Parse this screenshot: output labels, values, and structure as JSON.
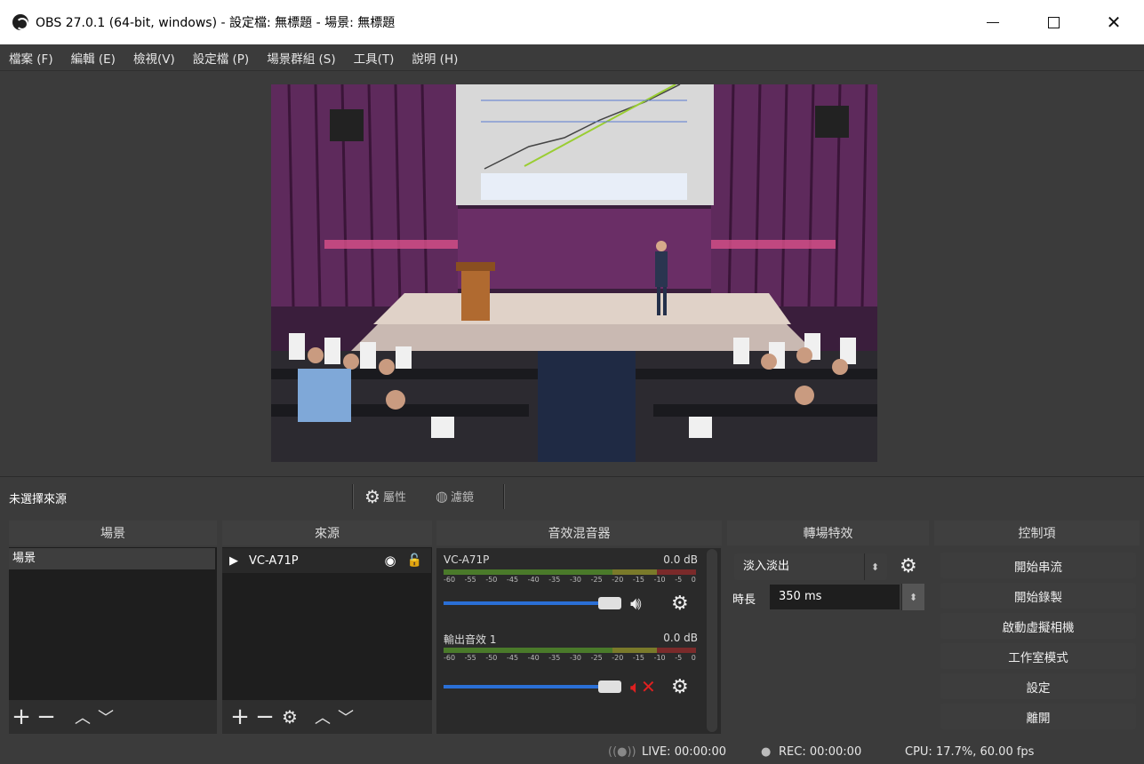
{
  "window": {
    "title": "OBS 27.0.1 (64-bit, windows) - 設定檔: 無標題 - 場景: 無標題",
    "minimize": "—",
    "close": "✕"
  },
  "menu": [
    "檔案 (F)",
    "編輯 (E)",
    "檢視(V)",
    "設定檔 (P)",
    "場景群組 (S)",
    "工具(T)",
    "說明 (H)"
  ],
  "context_bar": {
    "no_source": "未選擇來源",
    "properties": "屬性",
    "filters": "濾鏡"
  },
  "docks": {
    "scenes": "場景",
    "sources": "來源",
    "mixer": "音效混音器",
    "transitions": "轉場特效",
    "controls": "控制項"
  },
  "scenes": [
    "場景"
  ],
  "sources": [
    {
      "name": "VC-A71P"
    }
  ],
  "mixer": {
    "ticks": [
      "-60",
      "-55",
      "-50",
      "-45",
      "-40",
      "-35",
      "-30",
      "-25",
      "-20",
      "-15",
      "-10",
      "-5",
      "0"
    ],
    "channels": [
      {
        "name": "VC-A71P",
        "db": "0.0 dB",
        "muted": false,
        "volume": 1.0
      },
      {
        "name": "輸出音效 1",
        "db": "0.0 dB",
        "muted": true,
        "volume": 1.0
      }
    ]
  },
  "transitions": {
    "selected": "淡入淡出",
    "duration_label": "時長",
    "duration_value": "350 ms"
  },
  "controls": [
    "開始串流",
    "開始錄製",
    "啟動虛擬相機",
    "工作室模式",
    "設定",
    "離開"
  ],
  "status": {
    "live": "LIVE: 00:00:00",
    "rec": "REC: 00:00:00",
    "cpu": "CPU: 17.7%, 60.00 fps"
  },
  "colors": {
    "accent": "#2a6fd6",
    "mute_red": "#e02020"
  }
}
